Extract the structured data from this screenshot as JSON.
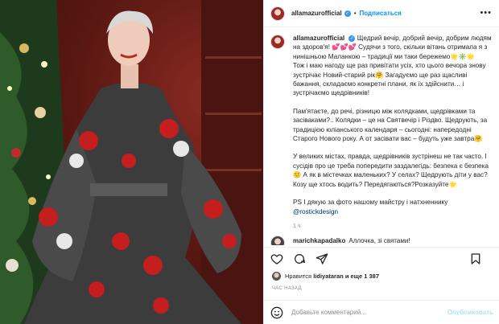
{
  "post": {
    "username": "allamazurofficial",
    "verified_mark": "✓",
    "follow_label": "Подписаться",
    "more_label": "•••"
  },
  "caption": {
    "p1": "Щедрий вечір, добрий вечір, добрим людям на здоров'я! 💕💕💕 Судячи з того, скільки вітань отримала я з нинішньою Маланкою – традиції ми таки бережемо🌟✳️🌟\nТож і маю нагоду ще раз привітати усіх, хто цього вечора знову зустрічає Новий-старий рік🤗 Загадуємо ще раз щасливі бажання, складаємо конкретні плани, як їх здійснити… і зустрічаємо щедрівників!",
    "p2": "Пам'ятаєте, до речі, різницю між колядками, щедрівками та засіваками?.. Колядки – це на Святвечір і Різдво. Щедрують, за традицією юліанського календаря – сьогодні: напередодні Старого Нового року. А от засівати вас – будуть уже завтра🤗",
    "p3": "У великих містах, правда, щедрівників зустрінеш не так часто. І сусідів про це треба попередити заздалегідь: безпека є безпека🙂 А як в містечках маленьких? У селах? Щедрують діти у вас? Козу ще хтось водить? Передягаються?Розказуйте🌟",
    "p4_text": "PS І дякую за фото нашому майстру і натхненнику",
    "p4_mention": "@rostickdesign",
    "time": "1 ч."
  },
  "comment": {
    "username": "marichkapadalko",
    "text": "Аллочка, зі святами!"
  },
  "likes": {
    "prefix": "Нравится",
    "user": "lidiyataran",
    "suffix": "и еще 1 387"
  },
  "time_ago": "ЧАС НАЗАД",
  "add_comment": {
    "placeholder": "Добавьте комментарий...",
    "publish_label": "Опубликовать"
  },
  "colors": {
    "accent": "#0095f6",
    "verified": "#3897f0",
    "mention": "#00376b",
    "publish_disabled": "#b2dffc"
  },
  "icons": [
    "more-icon",
    "heart-icon",
    "comment-icon",
    "share-icon",
    "bookmark-icon",
    "emoji-icon"
  ]
}
